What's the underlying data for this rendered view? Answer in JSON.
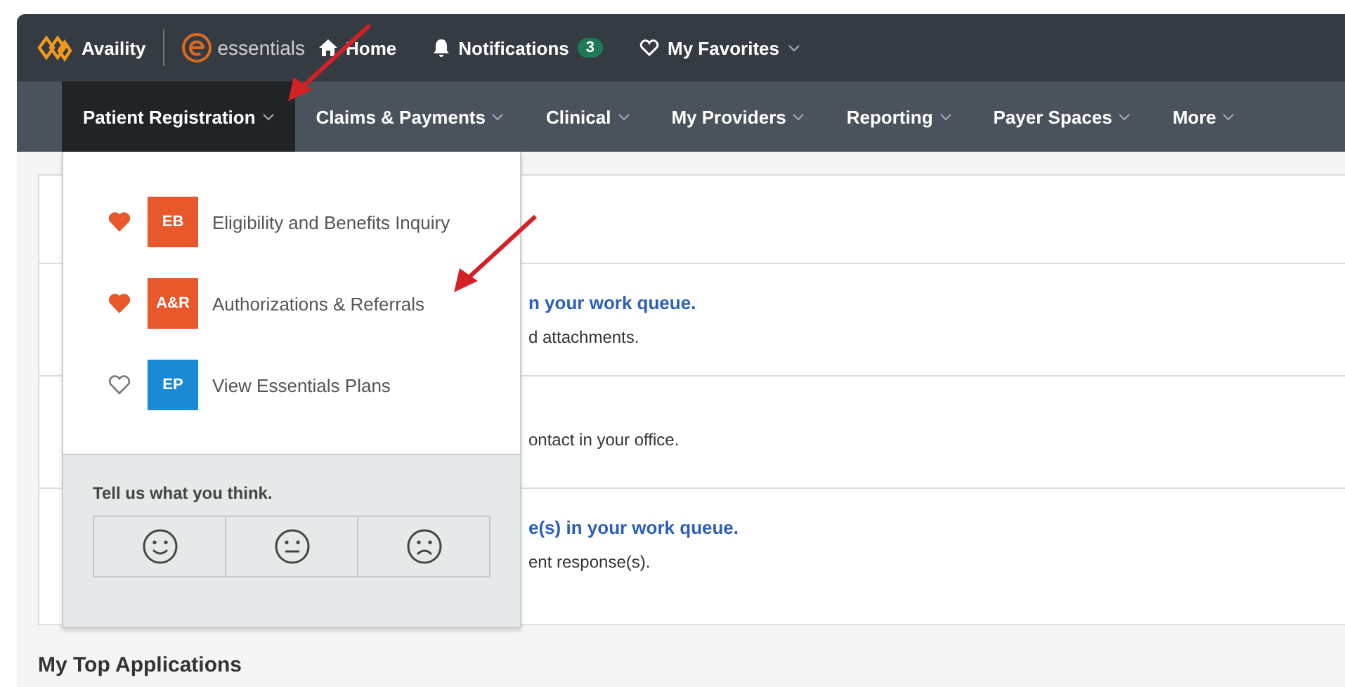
{
  "top_bar": {
    "brand": "Availity",
    "product": "essentials",
    "links": [
      {
        "kind": "home",
        "label": "Home"
      },
      {
        "kind": "notifications",
        "label": "Notifications",
        "badge": "3"
      },
      {
        "kind": "favorites",
        "label": "My Favorites",
        "dropdown": true
      }
    ]
  },
  "nav": [
    {
      "label": "Patient Registration",
      "selected": true
    },
    {
      "label": "Claims & Payments",
      "selected": false
    },
    {
      "label": "Clinical",
      "selected": false
    },
    {
      "label": "My Providers",
      "selected": false
    },
    {
      "label": "Reporting",
      "selected": false
    },
    {
      "label": "Payer Spaces",
      "selected": false
    },
    {
      "label": "More",
      "selected": false
    }
  ],
  "dropdown": {
    "items": [
      {
        "abbr": "EB",
        "label": "Eligibility and Benefits Inquiry",
        "favorite": true,
        "color": "#e8582a"
      },
      {
        "abbr": "A&R",
        "label": "Authorizations & Referrals",
        "favorite": true,
        "color": "#e8582a"
      },
      {
        "abbr": "EP",
        "label": "View Essentials Plans",
        "favorite": false,
        "color": "#1a8ad4"
      }
    ],
    "feedback": {
      "prompt": "Tell us what you think.",
      "options": [
        {
          "kind": "happy"
        },
        {
          "kind": "neutral"
        },
        {
          "kind": "sad"
        }
      ]
    }
  },
  "panel_rows": [
    {
      "title": "",
      "text": ""
    },
    {
      "title": "n your work queue.",
      "text": "d attachments."
    },
    {
      "title": "",
      "text": "ontact in your office."
    },
    {
      "title": "e(s) in your work queue.",
      "text": "ent response(s)."
    }
  ],
  "section_title": "My Top Applications"
}
